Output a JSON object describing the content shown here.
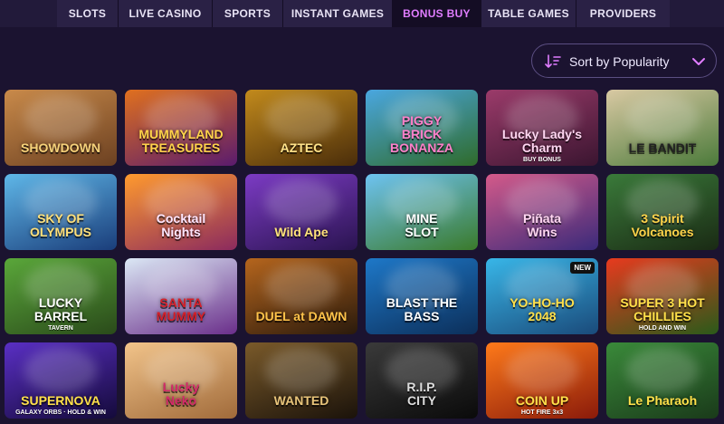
{
  "nav": {
    "tabs": [
      {
        "label": "SLOTS"
      },
      {
        "label": "LIVE CASINO"
      },
      {
        "label": "SPORTS"
      },
      {
        "label": "INSTANT GAMES"
      },
      {
        "label": "BONUS BUY"
      },
      {
        "label": "TABLE GAMES"
      },
      {
        "label": "PROVIDERS"
      }
    ],
    "active_tab": "BONUS BUY",
    "active_color": "#e07dff"
  },
  "sort": {
    "label": "Sort by Popularity",
    "icon": "sort-icon",
    "chevron": "chevron-down-icon",
    "accent": "#e07dff"
  },
  "games": [
    {
      "title": "SHOWDOWN",
      "sub": "",
      "bg": [
        "#c98a4a",
        "#6b4021"
      ],
      "color": "#f6d27a"
    },
    {
      "title": "MUMMYLAND\nTREASURES",
      "sub": "",
      "bg": [
        "#e0701e",
        "#5a1b6d"
      ],
      "color": "#ffd34a"
    },
    {
      "title": "AZTEC",
      "sub": "",
      "bg": [
        "#c28a1c",
        "#4a2d0a"
      ],
      "color": "#ffe38a"
    },
    {
      "title": "PIGGY\nBRICK BONANZA",
      "sub": "",
      "bg": [
        "#4aa7e0",
        "#2f6b2a"
      ],
      "color": "#ff7fc9"
    },
    {
      "title": "Lucky Lady's\nCharm",
      "sub": "BUY BONUS",
      "bg": [
        "#9b3b6a",
        "#3a1530"
      ],
      "color": "#ffd6f1"
    },
    {
      "title": "LE BANDIT",
      "sub": "",
      "bg": [
        "#d9c9a3",
        "#4b7a3a"
      ],
      "color": "#222222"
    },
    {
      "title": "SKY OF\nOLYMPUS",
      "sub": "",
      "bg": [
        "#5fb7e8",
        "#1a3d7a"
      ],
      "color": "#ffe07a"
    },
    {
      "title": "Cocktail\nNights",
      "sub": "",
      "bg": [
        "#ff9a2e",
        "#8b2a5e"
      ],
      "color": "#ffe6ff"
    },
    {
      "title": "Wild Ape",
      "sub": "",
      "bg": [
        "#7c3bc4",
        "#2a1450"
      ],
      "color": "#ffe27a"
    },
    {
      "title": "MINE\nSLOT",
      "sub": "",
      "bg": [
        "#6ec3f2",
        "#3a7a2a"
      ],
      "color": "#ffffff"
    },
    {
      "title": "Piñata\nWins",
      "sub": "",
      "bg": [
        "#d45a8a",
        "#3a2a7a"
      ],
      "color": "#ffd6f1"
    },
    {
      "title": "3 Spirit\nVolcanoes",
      "sub": "",
      "bg": [
        "#3a7a3a",
        "#1a2a14"
      ],
      "color": "#ffd34a"
    },
    {
      "title": "LUCKY\nBARREL",
      "sub": "TAVERN",
      "bg": [
        "#5aa73a",
        "#2a4a1a"
      ],
      "color": "#ffffff"
    },
    {
      "title": "SANTA\nMUMMY",
      "sub": "",
      "bg": [
        "#dbe8f5",
        "#6a2e8a"
      ],
      "color": "#d4202a"
    },
    {
      "title": "DUEL at DAWN",
      "sub": "",
      "bg": [
        "#b5651d",
        "#2a1a0c"
      ],
      "color": "#ffc34a"
    },
    {
      "title": "BLAST THE\nBASS",
      "sub": "",
      "bg": [
        "#1e78c8",
        "#0c2f5a"
      ],
      "color": "#ffffff"
    },
    {
      "title": "YO-HO-HO\n2048",
      "sub": "",
      "bg": [
        "#38b6e8",
        "#1a4a7a"
      ],
      "color": "#ffe04a",
      "badge": "NEW"
    },
    {
      "title": "SUPER 3 HOT\nCHILLIES",
      "sub": "HOLD AND WIN",
      "bg": [
        "#e83a1e",
        "#2a5a1a"
      ],
      "color": "#ffe04a"
    },
    {
      "title": "SUPERNOVA",
      "sub": "GALAXY ORBS · HOLD & WIN",
      "bg": [
        "#5a2fc4",
        "#140a3a"
      ],
      "color": "#ffe04a"
    },
    {
      "title": "Lucky\nNeko",
      "sub": "",
      "bg": [
        "#f2c48a",
        "#a06a3a"
      ],
      "color": "#d42a6a"
    },
    {
      "title": "WANTED",
      "sub": "",
      "bg": [
        "#7a5a2a",
        "#1a120a"
      ],
      "color": "#e8c47a"
    },
    {
      "title": "R.I.P.\nCITY",
      "sub": "",
      "bg": [
        "#3a3a3a",
        "#0a0a0a"
      ],
      "color": "#dddddd"
    },
    {
      "title": "COIN UP",
      "sub": "HOT FIRE 3x3",
      "bg": [
        "#ff7a1a",
        "#8a1a0a"
      ],
      "color": "#ffe04a"
    },
    {
      "title": "Le Pharaoh",
      "sub": "",
      "bg": [
        "#3a8a3a",
        "#1a3a1a"
      ],
      "color": "#ffe04a"
    }
  ]
}
